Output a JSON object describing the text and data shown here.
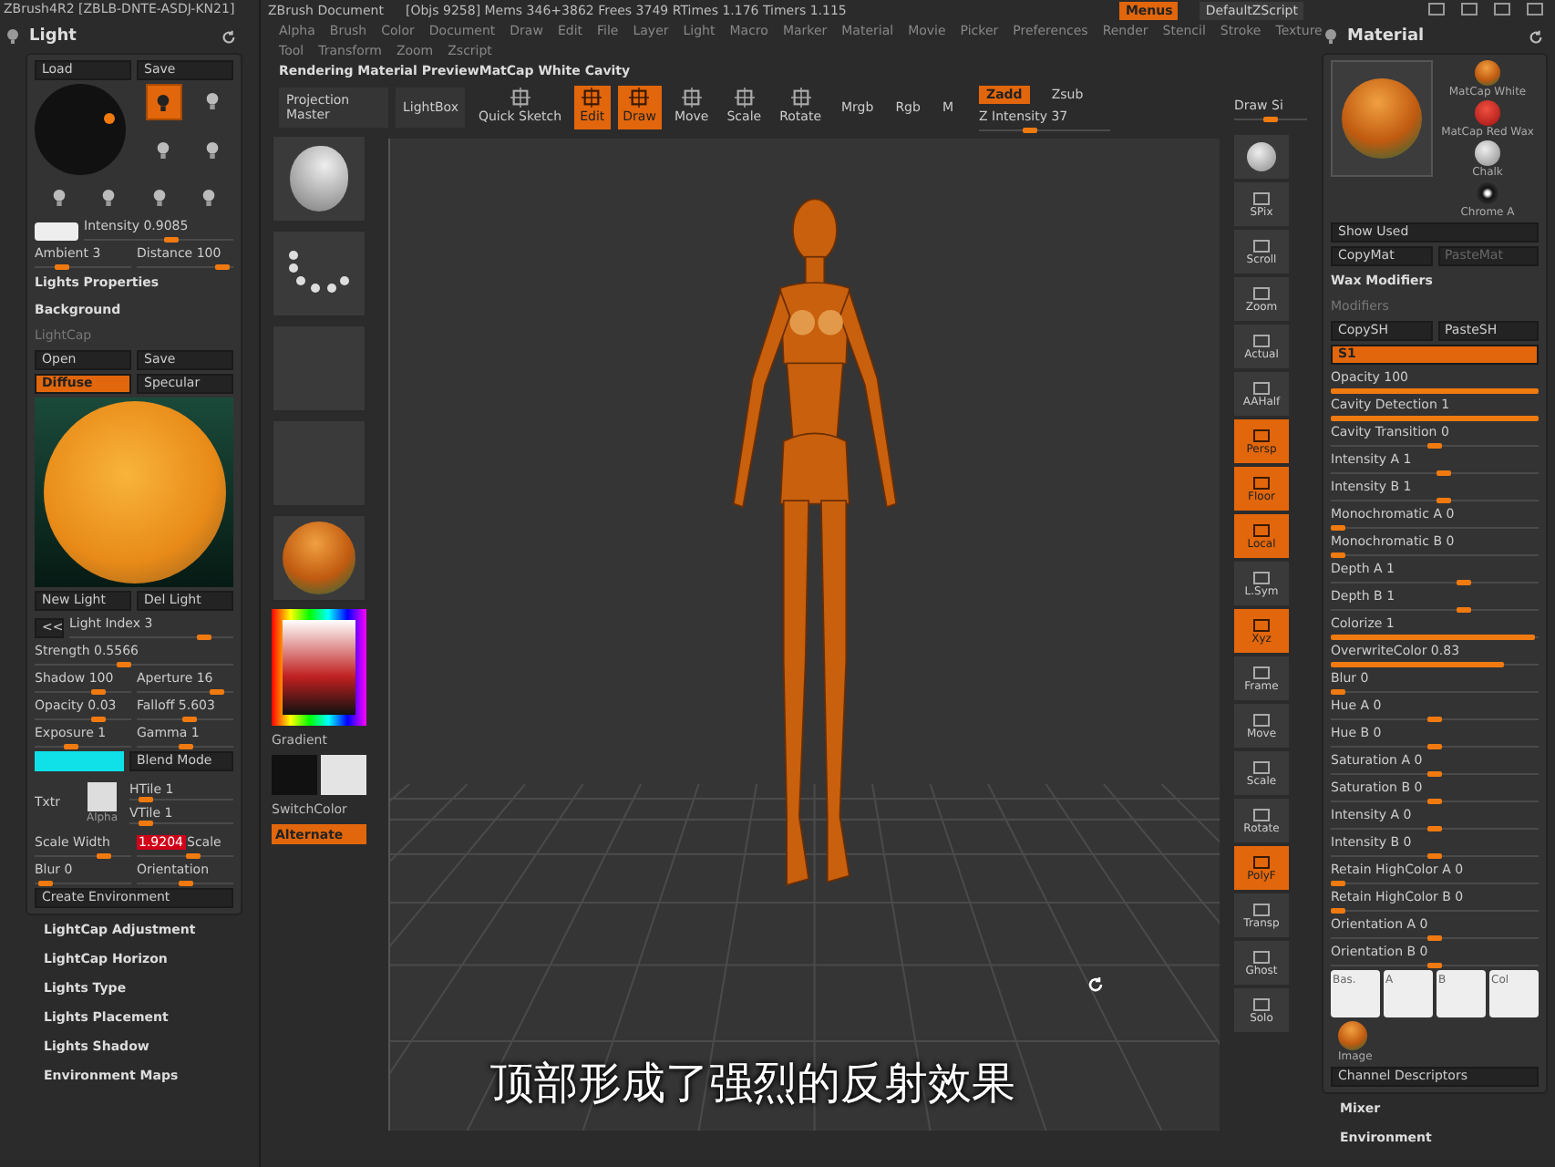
{
  "app_title": "ZBrush4R2 [ZBLB-DNTE-ASDJ-KN21]",
  "title_bar": {
    "document": "ZBrush Document",
    "stats": "[Objs 9258] Mems 346+3862 Frees 3749 RTimes 1.176 Timers 1.115",
    "buttons": [
      {
        "label": "Menus",
        "selected": true
      },
      {
        "label": "DefaultZScript",
        "selected": false
      }
    ]
  },
  "menu_rows": [
    [
      "Alpha",
      "Brush",
      "Color",
      "Document",
      "Draw",
      "Edit",
      "File",
      "Layer",
      "Light",
      "Macro",
      "Marker",
      "Material",
      "Movie",
      "Picker",
      "Preferences",
      "Render",
      "Stencil",
      "Stroke",
      "Texture"
    ],
    [
      "Tool",
      "Transform",
      "Zoom",
      "Zscript"
    ]
  ],
  "status": "Rendering Material PreviewMatCap White Cavity",
  "toolbar": [
    {
      "kind": "button",
      "label": "Projection Master"
    },
    {
      "kind": "button",
      "label": "LightBox"
    },
    {
      "kind": "tool",
      "label": "Quick Sketch",
      "selected": false
    },
    {
      "kind": "tool",
      "label": "Edit",
      "selected": true
    },
    {
      "kind": "tool",
      "label": "Draw",
      "selected": true
    },
    {
      "kind": "tool",
      "label": "Move",
      "selected": false
    },
    {
      "kind": "tool",
      "label": "Scale",
      "selected": false
    },
    {
      "kind": "tool",
      "label": "Rotate",
      "selected": false
    },
    {
      "kind": "toggle",
      "label": "Mrgb",
      "selected": false
    },
    {
      "kind": "toggle",
      "label": "Rgb",
      "selected": false
    },
    {
      "kind": "toggle",
      "label": "M",
      "selected": false
    },
    {
      "kind": "zmode",
      "buttons": [
        {
          "label": "Zadd",
          "selected": true
        },
        {
          "label": "Zsub",
          "selected": false
        }
      ],
      "slider": {
        "label": "Z Intensity 37",
        "level": 0.37
      }
    },
    {
      "kind": "slider",
      "label": "Draw Si",
      "level": 0.5
    }
  ],
  "light_panel": {
    "title": "Light",
    "items": [
      {
        "kind": "buttons",
        "buttons": [
          {
            "label": "Load",
            "selected": false
          },
          {
            "label": "Save",
            "selected": false
          }
        ]
      },
      {
        "kind": "light-grid",
        "lights": [
          {
            "selected": true
          },
          {
            "selected": false
          },
          {
            "selected": false
          },
          {
            "selected": false
          },
          {
            "selected": false
          },
          {
            "selected": false
          },
          {
            "selected": false
          },
          {
            "selected": false
          }
        ]
      },
      {
        "kind": "swatch-slider",
        "label": "Intensity 0.9085",
        "level": 0.6
      },
      {
        "kind": "sliders",
        "sliders": [
          {
            "label": "Ambient 3",
            "level": 0.25
          },
          {
            "label": "Distance 100",
            "level": 0.95
          }
        ]
      },
      {
        "kind": "heading",
        "label": "Lights Properties"
      },
      {
        "kind": "heading",
        "label": "Background"
      },
      {
        "kind": "subheading",
        "label": "LightCap"
      },
      {
        "kind": "buttons",
        "buttons": [
          {
            "label": "Open",
            "selected": false
          },
          {
            "label": "Save",
            "selected": false
          }
        ]
      },
      {
        "kind": "buttons",
        "buttons": [
          {
            "label": "Diffuse",
            "selected": true
          },
          {
            "label": "Specular",
            "selected": false
          }
        ]
      },
      {
        "kind": "preview"
      },
      {
        "kind": "buttons",
        "buttons": [
          {
            "label": "New Light",
            "selected": false
          },
          {
            "label": "Del Light",
            "selected": false
          }
        ]
      },
      {
        "kind": "index-slider",
        "button": "<<",
        "label": "Light Index 3",
        "level": 0.85
      },
      {
        "kind": "sliders",
        "sliders": [
          {
            "label": "Strength 0.5566",
            "level": 0.45
          }
        ]
      },
      {
        "kind": "sliders",
        "sliders": [
          {
            "label": "Shadow 100",
            "level": 0.7
          },
          {
            "label": "Aperture 16",
            "level": 0.9
          }
        ]
      },
      {
        "kind": "sliders",
        "sliders": [
          {
            "label": "Opacity 0.03",
            "level": 0.7
          },
          {
            "label": "Falloff 5.603",
            "level": 0.55
          }
        ]
      },
      {
        "kind": "sliders",
        "sliders": [
          {
            "label": "Exposure 1",
            "level": 0.35
          },
          {
            "label": "Gamma 1",
            "level": 0.5
          }
        ]
      },
      {
        "kind": "color-blend",
        "color": "#10e0e8",
        "label": "Blend Mode"
      },
      {
        "kind": "texture",
        "label": "Txtr",
        "alpha": "Alpha",
        "sliders": [
          {
            "label": "HTile 1",
            "level": 0.1
          },
          {
            "label": "VTile 1",
            "level": 0.1
          }
        ]
      },
      {
        "kind": "sliders",
        "sliders": [
          {
            "label": "Scale Width",
            "level": 0.75
          },
          {
            "label": "Scale",
            "value": "1.9204",
            "level": 0.6
          }
        ]
      },
      {
        "kind": "sliders",
        "sliders": [
          {
            "label": "Blur 0",
            "level": 0.05
          },
          {
            "label": "Orientation",
            "level": 0.5
          }
        ]
      },
      {
        "kind": "wide-button",
        "label": "Create Environment"
      }
    ],
    "headings": [
      "LightCap Adjustment",
      "LightCap Horizon",
      "Lights Type",
      "Lights Placement",
      "Lights Shadow",
      "Environment Maps"
    ]
  },
  "left_shelf": {
    "thumbs": [
      {
        "kind": "brush"
      },
      {
        "kind": "stroke"
      },
      {
        "kind": "blank"
      },
      {
        "kind": "blank"
      },
      {
        "kind": "material"
      }
    ],
    "gradient": "Gradient",
    "switch_color": "SwitchColor",
    "alternate": "Alternate"
  },
  "right_shelf": [
    {
      "label": "SPix",
      "selected": false
    },
    {
      "label": "Scroll",
      "selected": false
    },
    {
      "label": "Zoom",
      "selected": false
    },
    {
      "label": "Actual",
      "selected": false
    },
    {
      "label": "AAHalf",
      "selected": false
    },
    {
      "label": "Persp",
      "selected": true
    },
    {
      "label": "Floor",
      "selected": true
    },
    {
      "label": "Local",
      "selected": true
    },
    {
      "label": "L.Sym",
      "selected": false
    },
    {
      "label": "Xyz",
      "selected": true
    },
    {
      "label": "Frame",
      "selected": false
    },
    {
      "label": "Move",
      "selected": false
    },
    {
      "label": "Scale",
      "selected": false
    },
    {
      "label": "Rotate",
      "selected": false
    },
    {
      "label": "PolyF",
      "selected": true
    },
    {
      "label": "Transp",
      "selected": false
    },
    {
      "label": "Ghost",
      "selected": false
    },
    {
      "label": "Solo",
      "selected": false
    }
  ],
  "material_panel": {
    "title": "Material",
    "items": [
      {
        "kind": "materials",
        "materials": [
          "MatCap White",
          "MatCap Red Wax",
          "Chalk",
          "Chrome A"
        ]
      },
      {
        "kind": "wide-button",
        "label": "Show Used"
      },
      {
        "kind": "buttons",
        "buttons": [
          {
            "label": "CopyMat",
            "selected": false,
            "disabled": false
          },
          {
            "label": "PasteMat",
            "selected": false,
            "disabled": true
          }
        ]
      },
      {
        "kind": "heading",
        "label": "Wax Modifiers"
      },
      {
        "kind": "subheading",
        "label": "Modifiers"
      },
      {
        "kind": "buttons",
        "buttons": [
          {
            "label": "CopySH",
            "selected": false
          },
          {
            "label": "PasteSH",
            "selected": false
          }
        ]
      },
      {
        "kind": "buttons",
        "buttons": [
          {
            "label": "S1",
            "selected": true
          }
        ]
      },
      {
        "kind": "sliders",
        "sliders": [
          {
            "label": "Opacity 100",
            "level": 1
          }
        ]
      },
      {
        "kind": "sliders",
        "sliders": [
          {
            "label": "Cavity Detection 1",
            "level": 1
          }
        ]
      },
      {
        "kind": "sliders",
        "sliders": [
          {
            "label": "Cavity Transition 0",
            "level": 0.5
          }
        ]
      },
      {
        "kind": "sliders",
        "sliders": [
          {
            "label": "Intensity A 1",
            "level": 0.55
          }
        ]
      },
      {
        "kind": "sliders",
        "sliders": [
          {
            "label": "Intensity B 1",
            "level": 0.55
          }
        ]
      },
      {
        "kind": "sliders",
        "sliders": [
          {
            "label": "Monochromatic A 0",
            "level": 0
          }
        ]
      },
      {
        "kind": "sliders",
        "sliders": [
          {
            "label": "Monochromatic B 0",
            "level": 0
          }
        ]
      },
      {
        "kind": "sliders",
        "sliders": [
          {
            "label": "Depth A 1",
            "level": 0.65
          }
        ]
      },
      {
        "kind": "sliders",
        "sliders": [
          {
            "label": "Depth B 1",
            "level": 0.65
          }
        ]
      },
      {
        "kind": "sliders",
        "sliders": [
          {
            "label": "Colorize 1",
            "level": 0.98
          }
        ]
      },
      {
        "kind": "sliders",
        "sliders": [
          {
            "label": "OverwriteColor 0.83",
            "level": 0.83
          }
        ]
      },
      {
        "kind": "sliders",
        "sliders": [
          {
            "label": "Blur 0",
            "level": 0
          }
        ]
      },
      {
        "kind": "sliders",
        "sliders": [
          {
            "label": "Hue A 0",
            "level": 0.5
          }
        ]
      },
      {
        "kind": "sliders",
        "sliders": [
          {
            "label": "Hue B 0",
            "level": 0.5
          }
        ]
      },
      {
        "kind": "sliders",
        "sliders": [
          {
            "label": "Saturation A 0",
            "level": 0.5
          }
        ]
      },
      {
        "kind": "sliders",
        "sliders": [
          {
            "label": "Saturation B 0",
            "level": 0.5
          }
        ]
      },
      {
        "kind": "sliders",
        "sliders": [
          {
            "label": "Intensity A 0",
            "level": 0.5
          }
        ]
      },
      {
        "kind": "sliders",
        "sliders": [
          {
            "label": "Intensity B 0",
            "level": 0.5
          }
        ]
      },
      {
        "kind": "sliders",
        "sliders": [
          {
            "label": "Retain HighColor A 0",
            "level": 0
          }
        ]
      },
      {
        "kind": "sliders",
        "sliders": [
          {
            "label": "Retain HighColor B 0",
            "level": 0
          }
        ]
      },
      {
        "kind": "sliders",
        "sliders": [
          {
            "label": "Orientation A 0",
            "level": 0.5
          }
        ]
      },
      {
        "kind": "sliders",
        "sliders": [
          {
            "label": "Orientation B 0",
            "level": 0.5
          }
        ]
      },
      {
        "kind": "curves",
        "labels": [
          "Bas.",
          "A",
          "B",
          "Col"
        ]
      },
      {
        "kind": "image",
        "label": "Image"
      },
      {
        "kind": "wide-button",
        "label": "Channel Descriptors"
      }
    ],
    "headings": [
      "Mixer",
      "Environment"
    ]
  },
  "subtitle": "顶部形成了强烈的反射效果"
}
